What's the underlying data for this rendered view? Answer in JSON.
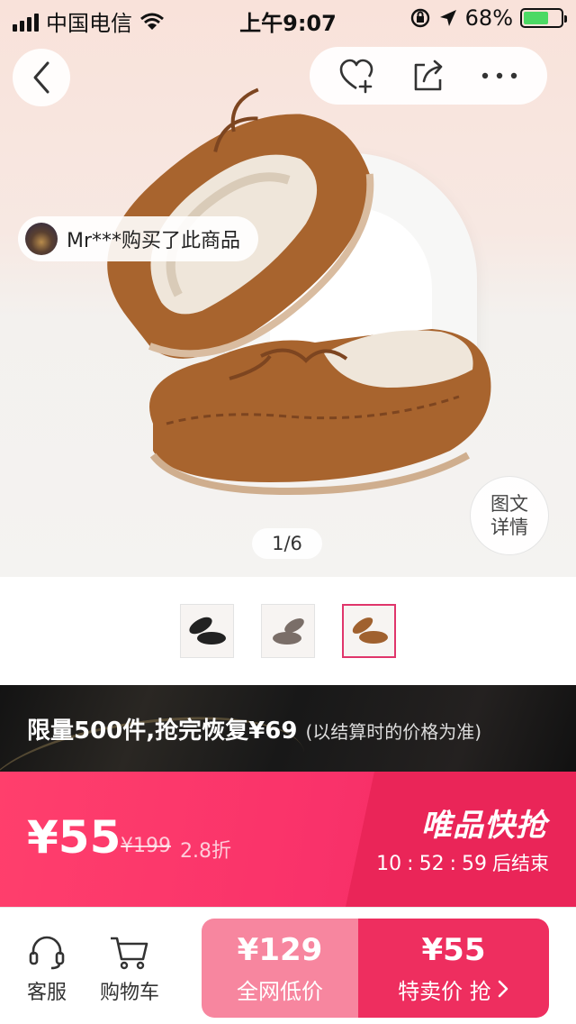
{
  "status_bar": {
    "carrier": "中国电信",
    "time": "上午9:07",
    "battery_percent": "68%",
    "battery_level": 0.68,
    "battery_color": "#4cd964"
  },
  "nav": {
    "back_icon": "chevron-left-icon",
    "favorite_icon": "heart-plus-icon",
    "share_icon": "share-icon",
    "more_icon": "more-dots-icon"
  },
  "hero": {
    "buyer_notice": "Mr***购买了此商品",
    "detail_button_line1": "图文",
    "detail_button_line2": "详情",
    "page_indicator": "1/6"
  },
  "thumbnails": {
    "items": [
      {
        "color": "#222222",
        "active": false
      },
      {
        "color": "#7a6e68",
        "active": false
      },
      {
        "color": "#a0612f",
        "active": true
      }
    ],
    "active_border_color": "#e0356b"
  },
  "promo": {
    "headline": "限量500件,抢完恢复¥69",
    "note": "(以结算时的价格为准)"
  },
  "price_banner": {
    "price": "¥55",
    "original_price": "¥199",
    "discount": "2.8折",
    "flash_title": "唯品快抢",
    "countdown_hours": "10",
    "countdown_minutes": "52",
    "countdown_seconds": "59",
    "countdown_separator": ":",
    "countdown_suffix": "后结束",
    "accent_color": "#f9326a"
  },
  "bottom_bar": {
    "service_label": "客服",
    "cart_label": "购物车",
    "low_price": "¥129",
    "low_price_label": "全网低价",
    "buy_price": "¥55",
    "buy_label": "特卖价 抢",
    "low_bg_color": "#f7869f",
    "buy_bg_color": "#ee2e5f"
  }
}
